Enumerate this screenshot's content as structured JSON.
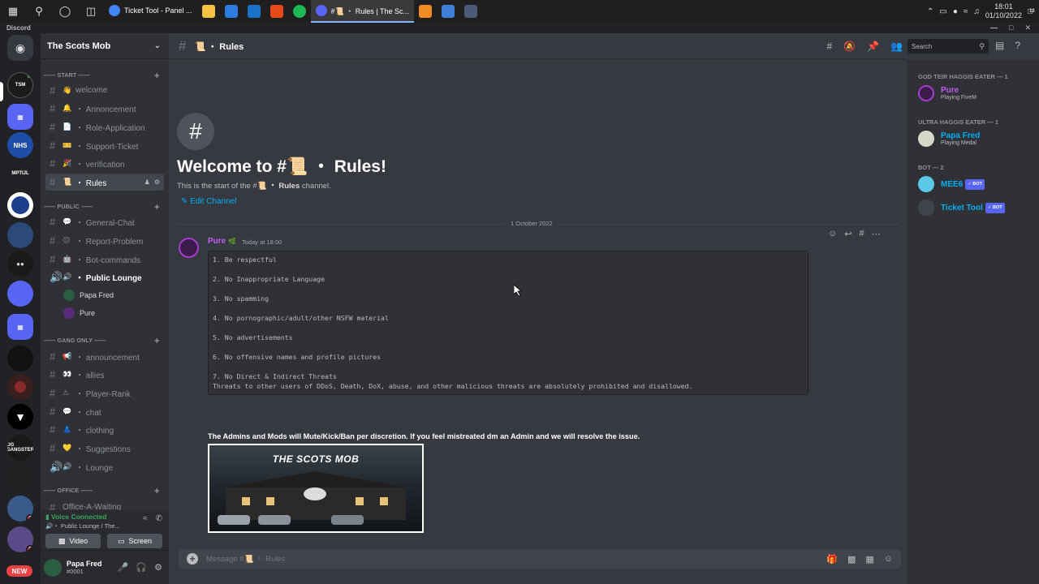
{
  "taskbar": {
    "tasks": [
      {
        "label": "Ticket Tool - Panel ...",
        "active": false
      },
      {
        "label": "#📜 ・ Rules | The Sc...",
        "active": true
      }
    ],
    "clock_time": "18:01",
    "clock_date": "01/10/2022",
    "notif_count": "13"
  },
  "app_title": "Discord",
  "server": {
    "name": "The Scots Mob",
    "categories": [
      {
        "label": "—— START ——"
      },
      {
        "label": "—— PUBLIC ——"
      },
      {
        "label": "—— GANG ONLY ——"
      },
      {
        "label": "—— OFFICE ——"
      }
    ],
    "channels": [
      {
        "emoji": "👋",
        "label": "welcome"
      },
      {
        "emoji": "🔔",
        "label": "・ Annoncement"
      },
      {
        "emoji": "📄",
        "label": "・ Role-Application"
      },
      {
        "emoji": "🎫",
        "label": "・ Support-Ticket"
      },
      {
        "emoji": "🎉",
        "label": "・ verification"
      },
      {
        "emoji": "📜",
        "label": "・ Rules"
      },
      {
        "emoji": "💬",
        "label": "・ General-Chat"
      },
      {
        "emoji": "😕",
        "label": "・ Report-Problem"
      },
      {
        "emoji": "🤖",
        "label": "・ Bot-commands"
      },
      {
        "emoji": "🔊",
        "label": "・ Public Lounge"
      },
      {
        "emoji": "📢",
        "label": "・ announcement"
      },
      {
        "emoji": "👀",
        "label": "・ allies"
      },
      {
        "emoji": "⚠",
        "label": "・ Player-Rank"
      },
      {
        "emoji": "💬",
        "label": "・ chat"
      },
      {
        "emoji": "👗",
        "label": "・ clothing"
      },
      {
        "emoji": "💛",
        "label": "・ Suggestions"
      },
      {
        "emoji": "🔊",
        "label": "・ Lounge"
      },
      {
        "emoji": "",
        "label": "Office-A-Waiting"
      }
    ],
    "voice_users": [
      "Papa Fred",
      "Pure"
    ]
  },
  "guilds": {
    "labels": [
      "NHS",
      "MPTIJL",
      "OG GANGSTER",
      "NEW"
    ],
    "badges": [
      "1",
      "2"
    ]
  },
  "voice": {
    "status": "Voice Connected",
    "channel": "・ Public Lounge / The...",
    "video_label": "Video",
    "screen_label": "Screen"
  },
  "user": {
    "name": "Papa Fred",
    "tag": "#0001"
  },
  "channel_header": {
    "title": "📜 ・ Rules",
    "search_placeholder": "Search"
  },
  "welcome": {
    "title": "Welcome to #📜 ・ Rules!",
    "sub_prefix": "This is the start of the #",
    "sub_channel": "📜 ・ Rules",
    "sub_suffix": " channel.",
    "edit_label": "Edit Channel"
  },
  "date_divider": "1 October 2022",
  "message": {
    "author": "Pure",
    "author_badge": "🌿",
    "timestamp": "Today at 18:00",
    "rules": [
      "1. Be respectful",
      "2. No Inappropriate Language",
      "3. No spamming",
      "4. No pornographic/adult/other NSFW material",
      "5. No advertisements",
      "6. No offensive names and profile pictures",
      "7. No Direct & Indirect Threats",
      "Threats to other users of DDoS, Death, DoX, abuse, and other malicious threats are absolutely prohibited and disallowed."
    ],
    "footer_bold": "The Admins and Mods will Mute/Kick/Ban per discretion. If you feel mistreated dm an Admin and we will resolve the issue.",
    "banner_title": "THE SCOTS MOB"
  },
  "composer": {
    "placeholder": "Message #📜 ・ Rules"
  },
  "members": {
    "groups": [
      {
        "heading": "GOD TEIR HAGGIS EATER — 1"
      },
      {
        "heading": "ULTRA HAGGIS EATER — 1"
      },
      {
        "heading": "BOT — 2"
      }
    ],
    "list": [
      {
        "name": "Pure",
        "activity": "Playing FiveM",
        "color": "#c45cf5",
        "bot": ""
      },
      {
        "name": "Papa Fred",
        "activity": "Playing Medal",
        "color": "#00aff4",
        "bot": ""
      },
      {
        "name": "MEE6",
        "activity": "",
        "color": "#00aff4",
        "bot": "✓ BOT"
      },
      {
        "name": "Ticket Tool",
        "activity": "",
        "color": "#00aff4",
        "bot": "✓ BOT"
      }
    ]
  }
}
